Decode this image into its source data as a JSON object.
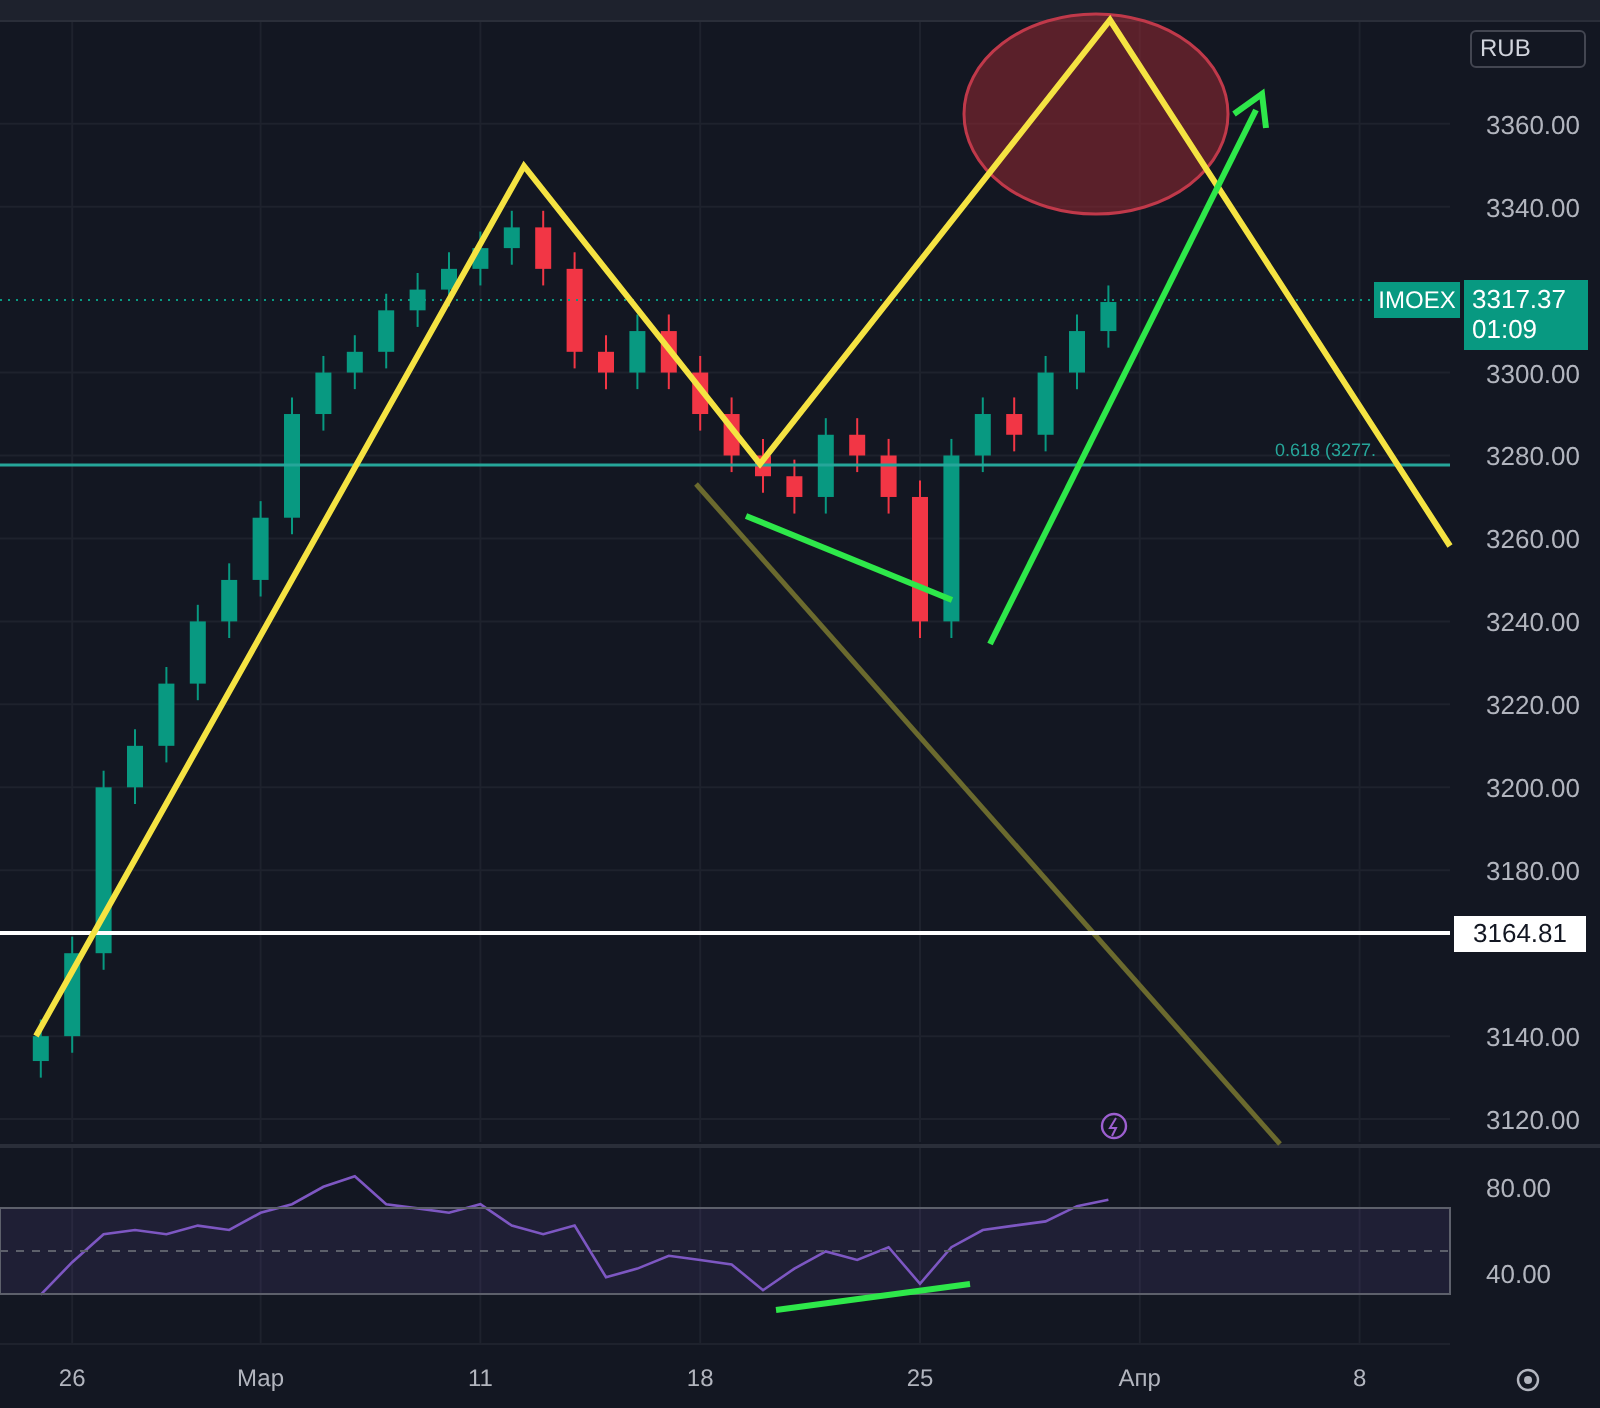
{
  "currency_button": {
    "label": "RUB"
  },
  "price_chart": {
    "chart_data": {
      "type": "candlestick",
      "grid": true,
      "categories": [
        null,
        null,
        null,
        null,
        null,
        null,
        null,
        null,
        null,
        null,
        null,
        null,
        null,
        null,
        null,
        null,
        null,
        null,
        null,
        null,
        null,
        null,
        null,
        null,
        null,
        null,
        null,
        null,
        null,
        null,
        null,
        null,
        null,
        null,
        null,
        null,
        null,
        null,
        null,
        null,
        null,
        null,
        null,
        null,
        null
      ],
      "ohlc": [
        [
          3134,
          3144,
          3130,
          3140
        ],
        [
          3140,
          3164,
          3136,
          3160
        ],
        [
          3160,
          3204,
          3156,
          3200
        ],
        [
          3200,
          3214,
          3196,
          3210
        ],
        [
          3210,
          3229,
          3206,
          3225
        ],
        [
          3225,
          3244,
          3221,
          3240
        ],
        [
          3240,
          3254,
          3236,
          3250
        ],
        [
          3250,
          3269,
          3246,
          3265
        ],
        [
          3265,
          3294,
          3261,
          3290
        ],
        [
          3290,
          3304,
          3286,
          3300
        ],
        [
          3300,
          3309,
          3296,
          3305
        ],
        [
          3305,
          3319,
          3301,
          3315
        ],
        [
          3315,
          3324,
          3311,
          3320
        ],
        [
          3320,
          3329,
          3316,
          3325
        ],
        [
          3325,
          3334,
          3321,
          3330
        ],
        [
          3330,
          3339,
          3326,
          3335
        ],
        [
          3335,
          3339,
          3321,
          3325
        ],
        [
          3325,
          3329,
          3301,
          3305
        ],
        [
          3305,
          3309,
          3296,
          3300
        ],
        [
          3300,
          3314,
          3296,
          3310
        ],
        [
          3310,
          3314,
          3296,
          3300
        ],
        [
          3300,
          3304,
          3286,
          3290
        ],
        [
          3290,
          3294,
          3276,
          3280
        ],
        [
          3280,
          3284,
          3271,
          3275
        ],
        [
          3275,
          3279,
          3266,
          3270
        ],
        [
          3270,
          3289,
          3266,
          3285
        ],
        [
          3285,
          3289,
          3276,
          3280
        ],
        [
          3280,
          3284,
          3266,
          3270
        ],
        [
          3270,
          3274,
          3236,
          3240
        ],
        [
          3240,
          3284,
          3236,
          3280
        ],
        [
          3280,
          3294,
          3276,
          3290
        ],
        [
          3290,
          3294,
          3281,
          3285
        ],
        [
          3285,
          3304,
          3281,
          3300
        ],
        [
          3300,
          3314,
          3296,
          3310
        ],
        [
          3310,
          3321,
          3306,
          3317
        ],
        null,
        null,
        null,
        null,
        null,
        null,
        null,
        null,
        null,
        null
      ],
      "ylim": [
        3114,
        3385
      ],
      "yticks": [
        {
          "value": 3360,
          "label": "3360.00"
        },
        {
          "value": 3340,
          "label": "3340.00"
        },
        {
          "value": 3300,
          "label": "3300.00"
        },
        {
          "value": 3280,
          "label": "3280.00"
        },
        {
          "value": 3260,
          "label": "3260.00"
        },
        {
          "value": 3240,
          "label": "3240.00"
        },
        {
          "value": 3220,
          "label": "3220.00"
        },
        {
          "value": 3200,
          "label": "3200.00"
        },
        {
          "value": 3180,
          "label": "3180.00"
        },
        {
          "value": 3140,
          "label": "3140.00"
        },
        {
          "value": 3120,
          "label": "3120.00"
        }
      ]
    },
    "symbol": "IMOEX",
    "last_price": "3317.37",
    "countdown": "01:09",
    "fib_label": "0.618 (3277.",
    "level_label": "3164.81"
  },
  "rsi_chart": {
    "chart_data": {
      "type": "line",
      "grid": true,
      "categories": [
        null,
        "26",
        null,
        null,
        null,
        null,
        null,
        "Мар",
        null,
        null,
        null,
        null,
        null,
        null,
        "11",
        null,
        null,
        null,
        null,
        null,
        null,
        "18",
        null,
        null,
        null,
        null,
        null,
        null,
        "25",
        null,
        null,
        null,
        null,
        null,
        null,
        "Апр",
        null,
        null,
        null,
        null,
        null,
        null,
        "8",
        null,
        null
      ],
      "series": [
        {
          "color": "#7e57c2",
          "values": [
            30,
            45,
            58,
            60,
            58,
            62,
            60,
            68,
            72,
            80,
            85,
            72,
            70,
            68,
            72,
            62,
            58,
            62,
            38,
            42,
            48,
            46,
            44,
            32,
            42,
            50,
            46,
            52,
            35,
            52,
            60,
            62,
            64,
            71,
            74,
            null,
            null,
            null,
            null,
            null,
            null,
            null,
            null,
            null,
            null
          ]
        }
      ],
      "ylim": [
        7,
        99
      ],
      "yticks": [
        {
          "value": 80,
          "label": "80.00"
        },
        {
          "value": 40,
          "label": "40.00"
        }
      ]
    }
  }
}
